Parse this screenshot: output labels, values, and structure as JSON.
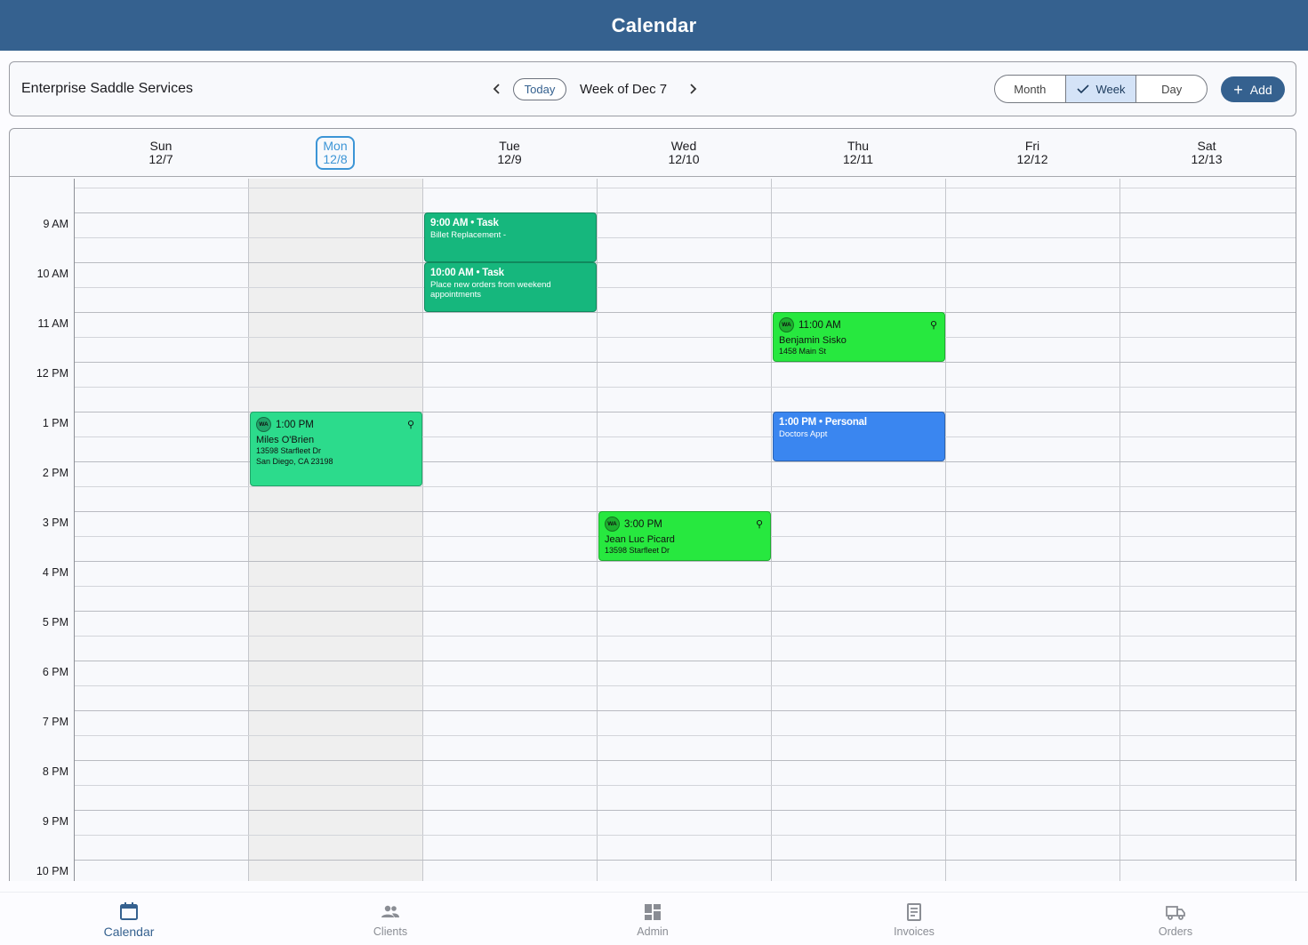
{
  "header": {
    "title": "Calendar"
  },
  "toolbar": {
    "company": "Enterprise Saddle Services",
    "prev_icon": "chevron-left-icon",
    "next_icon": "chevron-right-icon",
    "today_label": "Today",
    "week_label": "Week of Dec 7",
    "views": [
      {
        "label": "Month",
        "active": false
      },
      {
        "label": "Week",
        "active": true
      },
      {
        "label": "Day",
        "active": false
      }
    ],
    "add_label": "Add"
  },
  "days": [
    {
      "name": "Sun",
      "date": "12/7",
      "today": false
    },
    {
      "name": "Mon",
      "date": "12/8",
      "today": true
    },
    {
      "name": "Tue",
      "date": "12/9",
      "today": false
    },
    {
      "name": "Wed",
      "date": "12/10",
      "today": false
    },
    {
      "name": "Thu",
      "date": "12/11",
      "today": false
    },
    {
      "name": "Fri",
      "date": "12/12",
      "today": false
    },
    {
      "name": "Sat",
      "date": "12/13",
      "today": false
    }
  ],
  "hours": [
    "9 AM",
    "10 AM",
    "11 AM",
    "12 PM",
    "1 PM",
    "2 PM",
    "3 PM",
    "4 PM",
    "5 PM",
    "6 PM",
    "7 PM",
    "8 PM",
    "9 PM",
    "10 PM"
  ],
  "events": {
    "tue_task1": {
      "title": "9:00 AM • Task",
      "subtitle": "Billet Replacement -"
    },
    "tue_task2": {
      "title": "10:00 AM • Task",
      "subtitle": "Place new orders from weekend appointments"
    },
    "thu_appt": {
      "badge": "WA",
      "time": "11:00 AM",
      "name": "Benjamin Sisko",
      "addr1": "1458 Main St"
    },
    "mon_appt": {
      "badge": "WA",
      "time": "1:00 PM",
      "name": "Miles O'Brien",
      "addr1": "13598 Starfleet Dr",
      "addr2": "San Diego, CA 23198"
    },
    "thu_personal": {
      "title": "1:00 PM • Personal",
      "subtitle": "Doctors Appt"
    },
    "wed_appt": {
      "badge": "WA",
      "time": "3:00 PM",
      "name": "Jean Luc Picard",
      "addr1": "13598 Starfleet Dr"
    }
  },
  "colors": {
    "brand": "#35618f",
    "task": "#16b77d",
    "appointment": "#27e83f",
    "appointment_alt": "#2cdb8c",
    "personal": "#3a86f0",
    "today_accent": "#3c95d6"
  },
  "bottom_nav": [
    {
      "label": "Calendar",
      "icon": "calendar-icon",
      "active": true
    },
    {
      "label": "Clients",
      "icon": "people-icon",
      "active": false
    },
    {
      "label": "Admin",
      "icon": "dashboard-icon",
      "active": false
    },
    {
      "label": "Invoices",
      "icon": "receipt-icon",
      "active": false
    },
    {
      "label": "Orders",
      "icon": "truck-icon",
      "active": false
    }
  ]
}
